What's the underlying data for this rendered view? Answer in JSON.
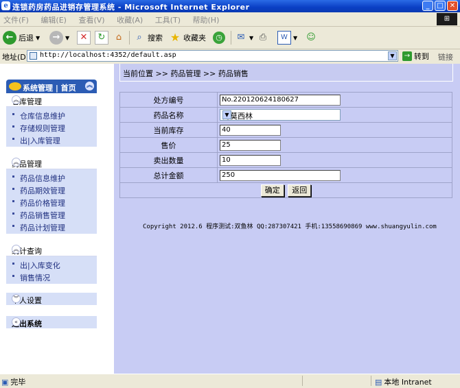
{
  "window": {
    "title": "连锁药房药品进销存管理系统 - Microsoft Internet Explorer",
    "minimize": "_",
    "maximize": "□",
    "close": "✕"
  },
  "menu": [
    "文件(F)",
    "编辑(E)",
    "查看(V)",
    "收藏(A)",
    "工具(T)",
    "帮助(H)"
  ],
  "toolbar": {
    "back_label": "后退",
    "search_label": "搜索",
    "favorites_label": "收藏夹"
  },
  "address": {
    "label": "地址(D)",
    "url": "http://localhost:4352/default.asp",
    "go_label": "转到",
    "links_label": "链接"
  },
  "sidebar": {
    "header": "系统管理 | 首页",
    "groups": [
      {
        "title": "仓库管理",
        "items": [
          "仓库信息维护",
          "存储规则管理",
          "出|入库管理"
        ]
      },
      {
        "title": "药品管理",
        "items": [
          "药品信息维护",
          "药品期效管理",
          "药品价格管理",
          "药品销售管理",
          "药品计划管理"
        ]
      },
      {
        "title": "统计查询",
        "items": [
          "出|入库变化",
          "销售情况"
        ]
      },
      {
        "title": "个人设置",
        "items": []
      },
      {
        "title": "退出系统",
        "items": []
      }
    ]
  },
  "breadcrumb": "当前位置 >> 药品管理 >> 药品销售",
  "form": {
    "rows": [
      {
        "label": "处方编号",
        "value": "No.220120624180627"
      },
      {
        "label": "药品名称",
        "value": "阿莫西林"
      },
      {
        "label": "当前库存",
        "value": "40"
      },
      {
        "label": "售价",
        "value": "25"
      },
      {
        "label": "卖出数量",
        "value": "10"
      },
      {
        "label": "总计金额",
        "value": "250"
      }
    ],
    "confirm_label": "确定",
    "back_label": "返回"
  },
  "footer": "Copyright 2012.6 程序测试:双鱼林 QQ:287307421 手机:13558690869 www.shuangyulin.com",
  "status": {
    "left": "完毕",
    "zone": "本地 Intranet"
  },
  "colors": {
    "main_bg": "#c8ccf4",
    "sidebar_item_bg": "#d6dff7",
    "title_blue": "#0a3fc4"
  }
}
